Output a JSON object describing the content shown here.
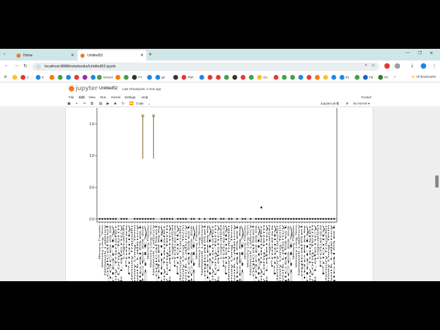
{
  "browser": {
    "tabs": [
      {
        "label": "Home",
        "active": false
      },
      {
        "label": "Untitled52",
        "active": true
      }
    ],
    "url": "localhost:8888/notebooks/Untitled52.ipynb",
    "bookmarks": [
      {
        "label": "C",
        "color": "#e53935"
      },
      {
        "label": "K",
        "color": "#1e88e5"
      },
      {
        "label": "School",
        "color": "#43a047"
      },
      {
        "label": "FY",
        "color": "#333333"
      },
      {
        "label": "git",
        "color": "#1e88e5"
      },
      {
        "label": "PDF",
        "color": "#e53935"
      },
      {
        "label": "Go",
        "color": "#fbc02d"
      },
      {
        "label": "IN",
        "color": "#1e88e5"
      },
      {
        "label": "FB",
        "color": "#1565c0"
      },
      {
        "label": "PC",
        "color": "#2e7d32"
      }
    ],
    "all_bookmarks": "All Bookmarks"
  },
  "jupyter": {
    "logo": "jupyter",
    "notebook_name": "Untitled52",
    "checkpoint": "Last Checkpoint: 1 hour ago",
    "menu": [
      "File",
      "Edit",
      "View",
      "Run",
      "Kernel",
      "Settings",
      "Help"
    ],
    "trusted": "Trusted",
    "cell_type": "Code",
    "jupyterlab_link": "JupyterLab",
    "kernel_status": "No Kernel"
  },
  "chart_data": {
    "type": "box",
    "yticks": [
      "1.5",
      "1.0",
      "0.5",
      "0.0"
    ],
    "ylim": [
      -0.05,
      1.75
    ],
    "n_boxes": 88,
    "category_label_fragments": [
      "Memory Transfer",
      "Memory Long-Term",
      "Network Latency",
      "LogicalSet",
      "Process",
      "Priority"
    ],
    "outlier_boxes": [
      {
        "index": 16,
        "median": 0.0,
        "q3": 0.95,
        "whisker_high": 1.62
      },
      {
        "index": 20,
        "median": 0.0,
        "q3": 0.95,
        "whisker_high": 1.62
      }
    ],
    "single_outlier": {
      "index": 60,
      "value": 0.18
    }
  }
}
